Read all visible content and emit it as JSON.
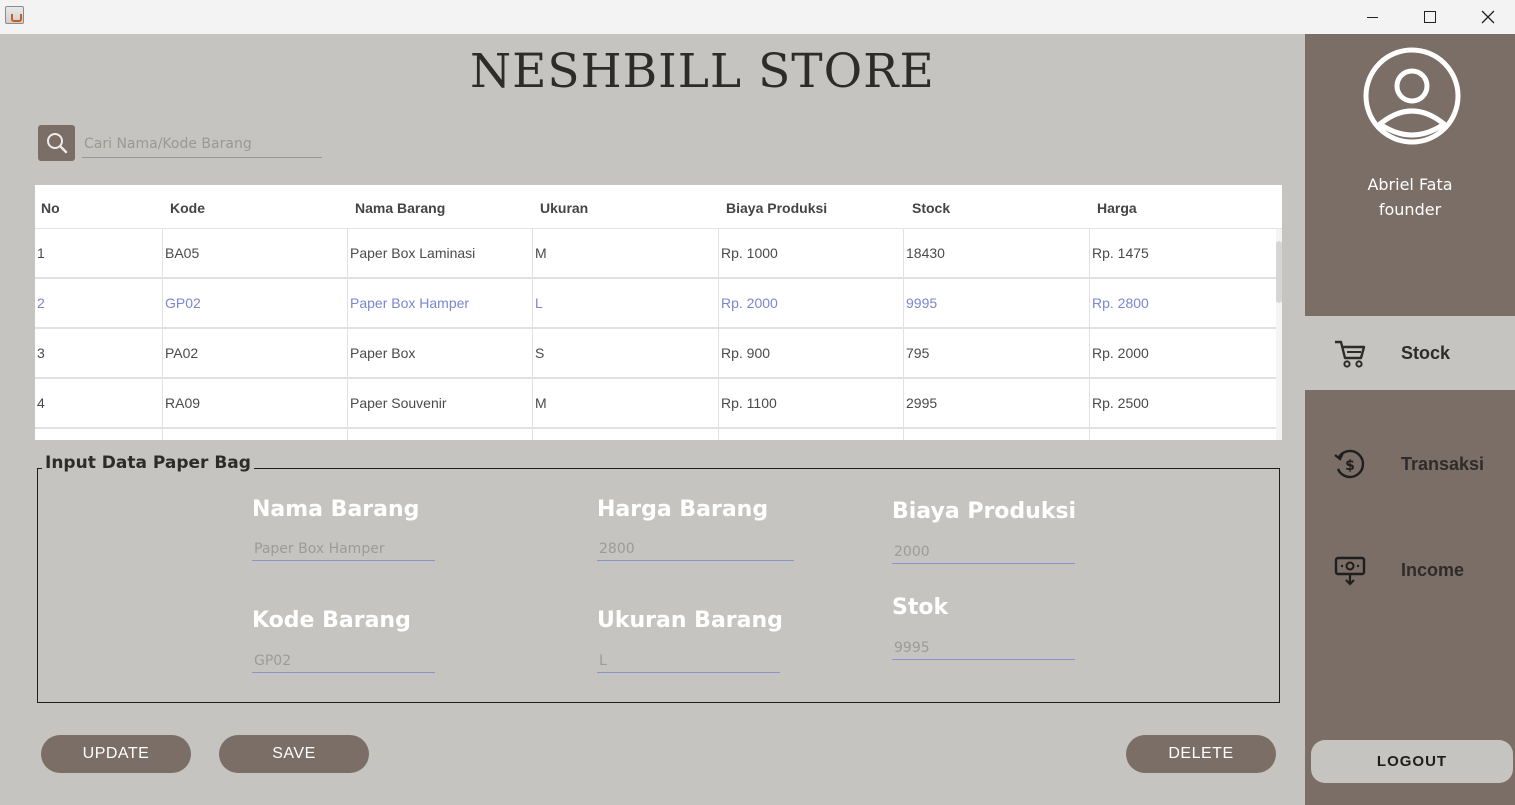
{
  "store_title": "NESHBILL STORE",
  "search": {
    "placeholder": "Cari Nama/Kode Barang"
  },
  "table": {
    "columns": [
      "No",
      "Kode",
      "Nama Barang",
      "Ukuran",
      "Biaya Produksi",
      "Stock",
      "Harga"
    ],
    "rows": [
      [
        "1",
        "BA05",
        "Paper Box Laminasi",
        "M",
        "Rp. 1000",
        "18430",
        "Rp. 1475"
      ],
      [
        "2",
        "GP02",
        "Paper Box Hamper",
        "L",
        "Rp. 2000",
        "9995",
        "Rp. 2800"
      ],
      [
        "3",
        "PA02",
        "Paper Box",
        "S",
        "Rp. 900",
        "795",
        "Rp. 2000"
      ],
      [
        "4",
        "RA09",
        "Paper Souvenir",
        "M",
        "Rp. 1100",
        "2995",
        "Rp. 2500"
      ]
    ],
    "selected_row": 2
  },
  "form": {
    "legend": "Input Data Paper Bag",
    "nama_barang": {
      "label": "Nama Barang",
      "value": "Paper Box Hamper"
    },
    "harga_barang": {
      "label": "Harga Barang",
      "value": "2800"
    },
    "biaya_produksi": {
      "label": "Biaya Produksi",
      "value": "2000"
    },
    "kode_barang": {
      "label": "Kode Barang",
      "value": "GP02"
    },
    "ukuran_barang": {
      "label": "Ukuran Barang",
      "value": "L"
    },
    "stok": {
      "label": "Stok",
      "value": "9995"
    }
  },
  "buttons": {
    "update": "UPDATE",
    "save": "SAVE",
    "delete": "DELETE"
  },
  "sidebar": {
    "user_name": "Abriel Fata",
    "user_role": "founder",
    "nav": [
      {
        "label": "Stock",
        "icon": "cart-icon",
        "active": true
      },
      {
        "label": "Transaksi",
        "icon": "money-history-icon",
        "active": false
      },
      {
        "label": "Income",
        "icon": "cash-withdraw-icon",
        "active": false
      }
    ],
    "logout": "LOGOUT"
  },
  "colors": {
    "background": "#c6c4c0",
    "sidebar": "#7b6e66",
    "accent_button": "#7b6e66",
    "selected_text": "#7b86d0",
    "title_text": "#2e2c2b"
  }
}
